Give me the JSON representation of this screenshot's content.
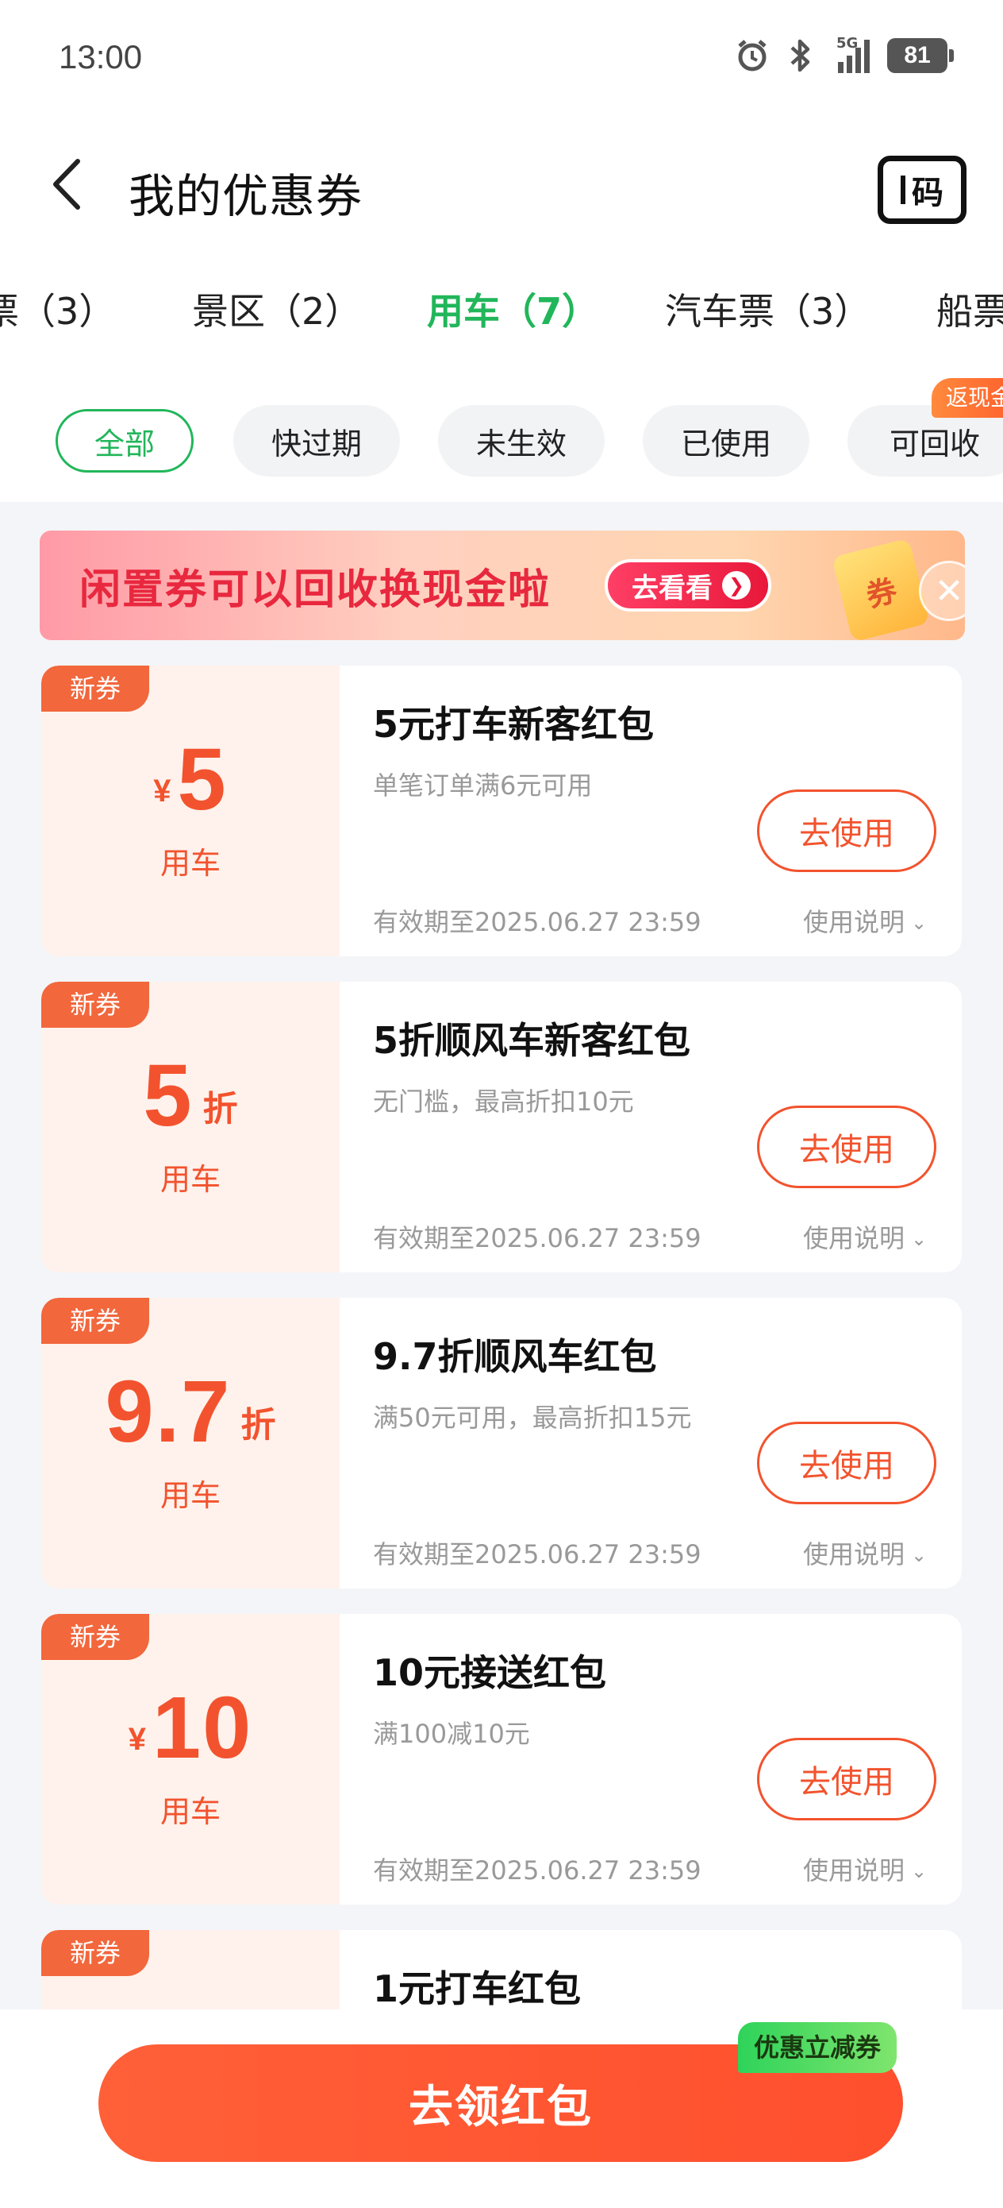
{
  "status_bar": {
    "time": "13:00",
    "network": "5G",
    "battery": "81",
    "icons": [
      "alarm-icon",
      "bluetooth-icon",
      "signal-icon",
      "battery-icon"
    ]
  },
  "header": {
    "title": "我的优惠券",
    "code_button": "码"
  },
  "category_tabs": [
    {
      "label": "票（3）",
      "active": false
    },
    {
      "label": "景区（2）",
      "active": false
    },
    {
      "label": "用车（7）",
      "active": true
    },
    {
      "label": "汽车票（3）",
      "active": false
    },
    {
      "label": "船票",
      "active": false
    }
  ],
  "filters": [
    {
      "label": "全部",
      "active": true
    },
    {
      "label": "快过期",
      "active": false
    },
    {
      "label": "未生效",
      "active": false
    },
    {
      "label": "已使用",
      "active": false
    },
    {
      "label": "可回收",
      "active": false
    }
  ],
  "filter_badge": "返现金",
  "banner": {
    "text": "闲置券可以回收换现金啦",
    "button": "去看看",
    "ticket_char": "券"
  },
  "coupons": [
    {
      "tag": "新券",
      "currency": "¥",
      "amount": "5",
      "unit": "",
      "category": "用车",
      "title": "5元打车新客红包",
      "condition": "单笔订单满6元可用",
      "button": "去使用",
      "expiry": "有效期至2025.06.27 23:59",
      "help": "使用说明"
    },
    {
      "tag": "新券",
      "currency": "",
      "amount": "5",
      "unit": "折",
      "category": "用车",
      "title": "5折顺风车新客红包",
      "condition": "无门槛，最高折扣10元",
      "button": "去使用",
      "expiry": "有效期至2025.06.27 23:59",
      "help": "使用说明"
    },
    {
      "tag": "新券",
      "currency": "",
      "amount": "9.7",
      "unit": "折",
      "category": "用车",
      "title": "9.7折顺风车红包",
      "condition": "满50元可用，最高折扣15元",
      "button": "去使用",
      "expiry": "有效期至2025.06.27 23:59",
      "help": "使用说明"
    },
    {
      "tag": "新券",
      "currency": "¥",
      "amount": "10",
      "unit": "",
      "category": "用车",
      "title": "10元接送红包",
      "condition": "满100减10元",
      "button": "去使用",
      "expiry": "有效期至2025.06.27 23:59",
      "help": "使用说明"
    },
    {
      "tag": "新券",
      "title": "1元打车红包"
    }
  ],
  "bottom": {
    "cta": "去领红包",
    "badge": "优惠立减券"
  },
  "colors": {
    "accent_green": "#21b65a",
    "coupon_red": "#f2532e",
    "cta_orange": "#ff5a33"
  }
}
